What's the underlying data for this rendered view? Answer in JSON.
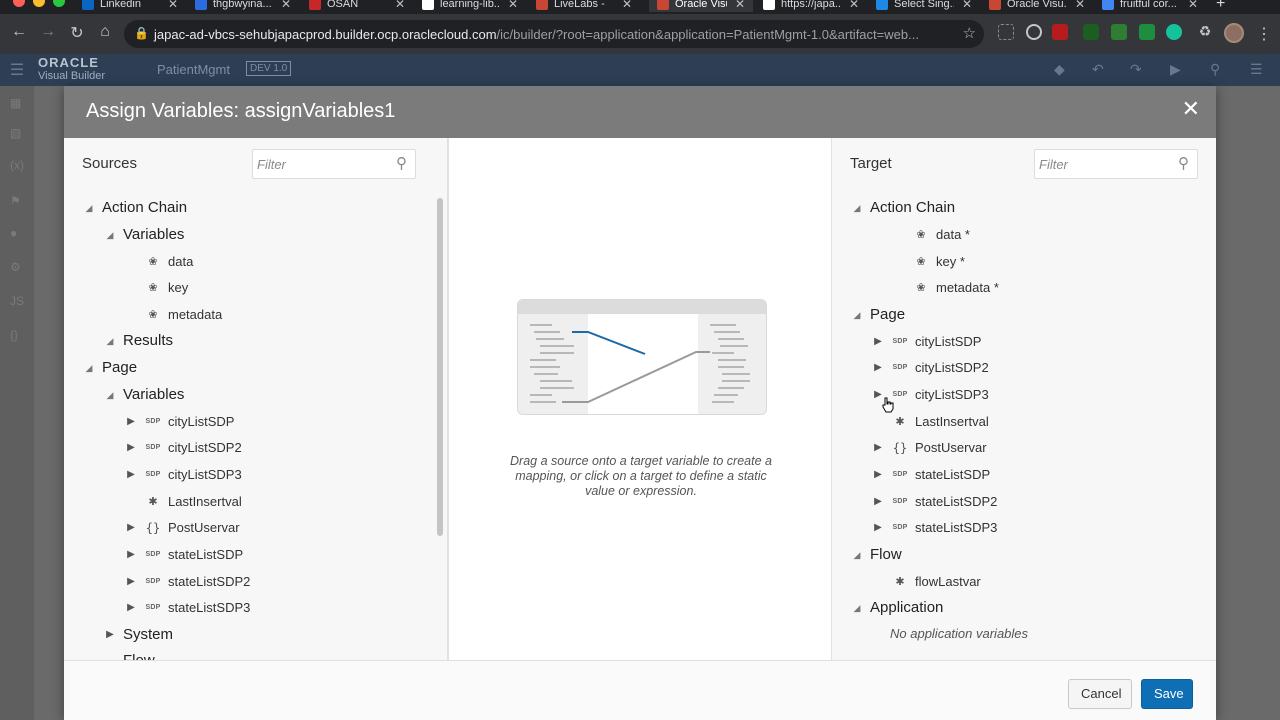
{
  "browser": {
    "tabs": [
      {
        "title": "Linkedin",
        "fav": "#0a66c2"
      },
      {
        "title": "thgbwyina...",
        "fav": "#2d6cdf"
      },
      {
        "title": "OSAN",
        "fav": "#c62828"
      },
      {
        "title": "learning-lib...",
        "fav": "#ffffff"
      },
      {
        "title": "LiveLabs -",
        "fav": "#c74634"
      },
      {
        "title": "Oracle Visu...",
        "fav": "#c74634"
      },
      {
        "title": "https://japa...",
        "fav": "#ffffff"
      },
      {
        "title": "Select Sing...",
        "fav": "#1e88e5"
      },
      {
        "title": "Oracle Visu...",
        "fav": "#c74634"
      },
      {
        "title": "fruitful cor...",
        "fav": "#4285f4"
      }
    ],
    "url_host": "japac-ad-vbcs-sehubjapacprod.builder.ocp.oraclecloud.com",
    "url_path": "/ic/builder/?root=application&application=PatientMgmt-1.0&artifact=web..."
  },
  "app": {
    "brand_top": "ORACLE",
    "brand_sub": "Visual Builder",
    "app_name": "PatientMgmt",
    "app_version": "DEV 1.0"
  },
  "dialog": {
    "title": "Assign Variables: assignVariables1",
    "sources": {
      "title": "Sources",
      "filter_placeholder": "Filter",
      "items": [
        {
          "label": "Action Chain",
          "level": 0,
          "head": true,
          "tw": "open"
        },
        {
          "label": "Variables",
          "level": 1,
          "head": true,
          "tw": "open"
        },
        {
          "label": "data",
          "level": 2,
          "icon": "var"
        },
        {
          "label": "key",
          "level": 2,
          "icon": "var"
        },
        {
          "label": "metadata",
          "level": 2,
          "icon": "var"
        },
        {
          "label": "Results",
          "level": 1,
          "head": true,
          "tw": "open"
        },
        {
          "label": "Page",
          "level": 0,
          "head": true,
          "tw": "open"
        },
        {
          "label": "Variables",
          "level": 1,
          "head": true,
          "tw": "open"
        },
        {
          "label": "cityListSDP",
          "level": 2,
          "icon": "sdp",
          "tw": "closed"
        },
        {
          "label": "cityListSDP2",
          "level": 2,
          "icon": "sdp",
          "tw": "closed"
        },
        {
          "label": "cityListSDP3",
          "level": 2,
          "icon": "sdp",
          "tw": "closed"
        },
        {
          "label": "LastInsertval",
          "level": 2,
          "icon": "any"
        },
        {
          "label": "PostUservar",
          "level": 2,
          "icon": "obj",
          "tw": "closed"
        },
        {
          "label": "stateListSDP",
          "level": 2,
          "icon": "sdp",
          "tw": "closed"
        },
        {
          "label": "stateListSDP2",
          "level": 2,
          "icon": "sdp",
          "tw": "closed"
        },
        {
          "label": "stateListSDP3",
          "level": 2,
          "icon": "sdp",
          "tw": "closed"
        },
        {
          "label": "System",
          "level": 1,
          "head": true,
          "tw": "closed"
        },
        {
          "label": "Flow",
          "level": 1,
          "head": true
        }
      ]
    },
    "middle": {
      "hint": "Drag a source onto a target variable to create a mapping, or click on a target to define a static value or expression."
    },
    "target": {
      "title": "Target",
      "filter_placeholder": "Filter",
      "items": [
        {
          "label": "Action Chain",
          "level": 0,
          "head": true,
          "tw": "open"
        },
        {
          "label": "data *",
          "level": 2,
          "icon": "var"
        },
        {
          "label": "key *",
          "level": 2,
          "icon": "var"
        },
        {
          "label": "metadata *",
          "level": 2,
          "icon": "var"
        },
        {
          "label": "Page",
          "level": 0,
          "head": true,
          "tw": "open"
        },
        {
          "label": "cityListSDP",
          "level": 1,
          "icon": "sdp",
          "tw": "closed"
        },
        {
          "label": "cityListSDP2",
          "level": 1,
          "icon": "sdp",
          "tw": "closed"
        },
        {
          "label": "cityListSDP3",
          "level": 1,
          "icon": "sdp",
          "tw": "closed"
        },
        {
          "label": "LastInsertval",
          "level": 1,
          "icon": "any"
        },
        {
          "label": "PostUservar",
          "level": 1,
          "icon": "obj",
          "tw": "closed"
        },
        {
          "label": "stateListSDP",
          "level": 1,
          "icon": "sdp",
          "tw": "closed"
        },
        {
          "label": "stateListSDP2",
          "level": 1,
          "icon": "sdp",
          "tw": "closed"
        },
        {
          "label": "stateListSDP3",
          "level": 1,
          "icon": "sdp",
          "tw": "closed"
        },
        {
          "label": "Flow",
          "level": 0,
          "head": true,
          "tw": "open"
        },
        {
          "label": "flowLastvar",
          "level": 1,
          "icon": "any"
        },
        {
          "label": "Application",
          "level": 0,
          "head": true,
          "tw": "open"
        }
      ],
      "empty_application": "No application variables"
    },
    "buttons": {
      "cancel": "Cancel",
      "save": "Save"
    }
  }
}
